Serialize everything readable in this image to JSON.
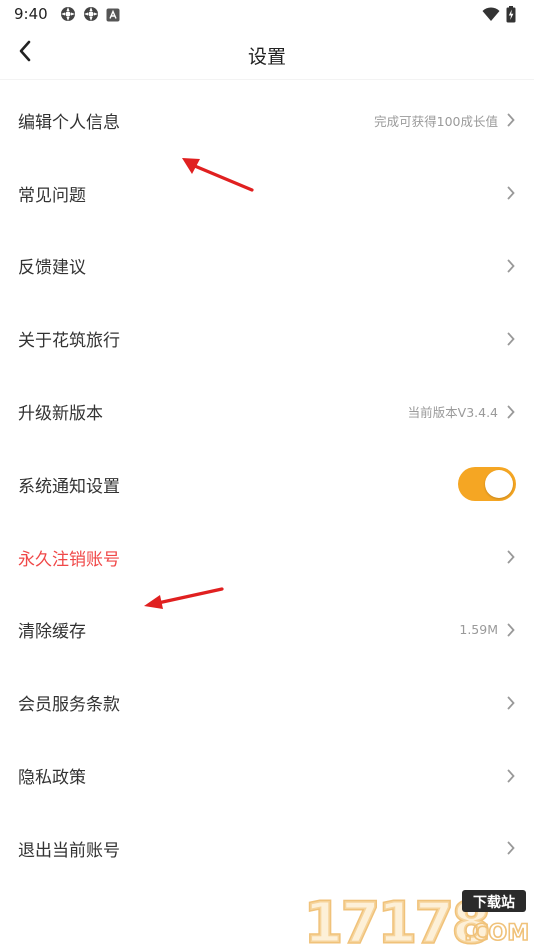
{
  "status_bar": {
    "time": "9:40",
    "icons_left": [
      "settings-gear-icon",
      "settings-gear-icon",
      "android-notification-icon"
    ],
    "icons_right": [
      "wifi-icon",
      "battery-charging-icon"
    ]
  },
  "header": {
    "title": "设置",
    "back_icon": "chevron-left-icon"
  },
  "settings": {
    "items": [
      {
        "label": "编辑个人信息",
        "value": "完成可获得100成长值"
      },
      {
        "label": "常见问题"
      },
      {
        "label": "反馈建议"
      },
      {
        "label": "关于花筑旅行"
      },
      {
        "label": "升级新版本",
        "value": "当前版本V3.4.4"
      },
      {
        "label": "系统通知设置",
        "toggle_on": true
      },
      {
        "label": "永久注销账号",
        "color": "#f04848"
      },
      {
        "label": "清除缓存",
        "value": "1.59M"
      },
      {
        "label": "会员服务条款"
      },
      {
        "label": "隐私政策"
      },
      {
        "label": "退出当前账号"
      }
    ]
  },
  "colors": {
    "toggle_accent": "#f5a623",
    "danger_text": "#f04848",
    "annotation_arrow": "#e02020"
  },
  "watermark": {
    "number": "17178",
    "tag": "下载站",
    "domain": ".COM"
  }
}
